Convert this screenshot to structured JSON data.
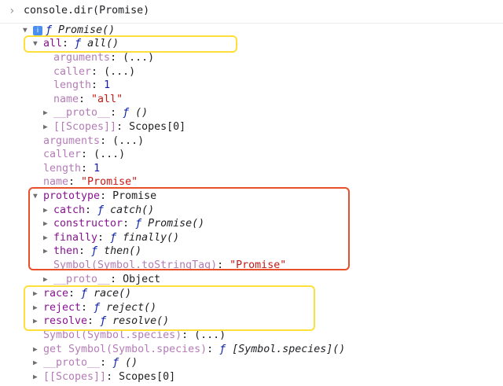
{
  "console": {
    "prompt_symbol": "›",
    "command": "console.dir(Promise)"
  },
  "tree": {
    "root": {
      "f": "ƒ",
      "name": "Promise()"
    },
    "all": {
      "key": "all",
      "f": "ƒ",
      "name": "all()",
      "arguments_key": "arguments",
      "arguments_val": "(...)",
      "caller_key": "caller",
      "caller_val": "(...)",
      "length_key": "length",
      "length_val": "1",
      "name_key": "name",
      "name_val": "\"all\"",
      "proto_key": "__proto__",
      "proto_f": "ƒ",
      "proto_val": "()",
      "scopes_key": "[[Scopes]]",
      "scopes_val": "Scopes[0]"
    },
    "arguments": {
      "key": "arguments",
      "val": "(...)"
    },
    "caller": {
      "key": "caller",
      "val": "(...)"
    },
    "length": {
      "key": "length",
      "val": "1"
    },
    "name": {
      "key": "name",
      "val": "\"Promise\""
    },
    "prototype": {
      "key": "prototype",
      "val": "Promise",
      "catch_key": "catch",
      "catch_f": "ƒ",
      "catch_val": "catch()",
      "constructor_key": "constructor",
      "constructor_f": "ƒ",
      "constructor_val": "Promise()",
      "finally_key": "finally",
      "finally_f": "ƒ",
      "finally_val": "finally()",
      "then_key": "then",
      "then_f": "ƒ",
      "then_val": "then()",
      "symbol_key": "Symbol(Symbol.toStringTag)",
      "symbol_val": "\"Promise\"",
      "proto_key": "__proto__",
      "proto_val": "Object"
    },
    "race": {
      "key": "race",
      "f": "ƒ",
      "val": "race()"
    },
    "reject": {
      "key": "reject",
      "f": "ƒ",
      "val": "reject()"
    },
    "resolve": {
      "key": "resolve",
      "f": "ƒ",
      "val": "resolve()"
    },
    "species": {
      "key": "Symbol(Symbol.species)",
      "val": "(...)"
    },
    "get_species": {
      "key": "get Symbol(Symbol.species)",
      "f": "ƒ",
      "val": "[Symbol.species]()"
    },
    "proto": {
      "key": "__proto__",
      "f": "ƒ",
      "val": "()"
    },
    "scopes": {
      "key": "[[Scopes]]",
      "val": "Scopes[0]"
    }
  },
  "colors": {
    "highlight_yellow": "#ffe03a",
    "highlight_red": "#e8502a",
    "property_key": "#881391",
    "number": "#1a1aa6",
    "string": "#c41a16"
  },
  "icons": {
    "expanded": "triangle-down",
    "collapsed": "triangle-right",
    "info": "info-badge"
  }
}
